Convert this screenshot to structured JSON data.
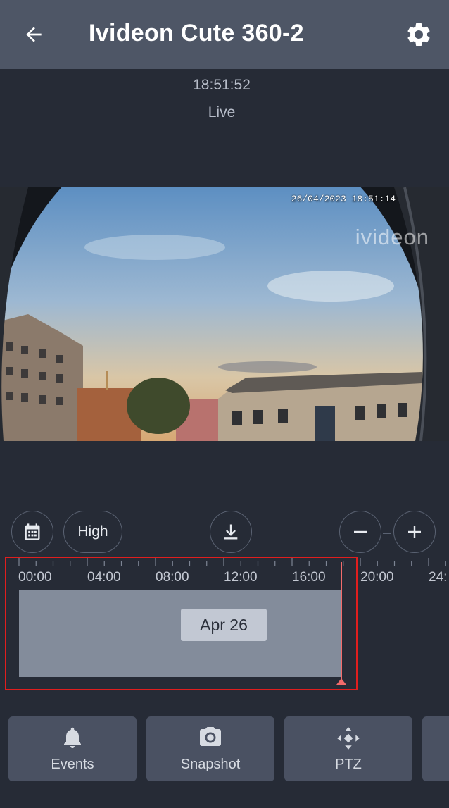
{
  "header": {
    "title": "Ivideon Cute 360-2",
    "back_icon": "arrow-left-icon",
    "settings_icon": "gear-icon"
  },
  "status": {
    "time": "18:51:52",
    "mode": "Live"
  },
  "video": {
    "overlay_timestamp": "26/04/2023 18:51:14",
    "watermark": "ivideon"
  },
  "controls": {
    "calendar_icon": "calendar-icon",
    "quality": "High",
    "download_icon": "download-icon",
    "zoom_out_icon": "minus-icon",
    "zoom_in_icon": "plus-icon"
  },
  "timeline": {
    "hour_labels": [
      "00:00",
      "04:00",
      "08:00",
      "12:00",
      "16:00",
      "20:00",
      "24:"
    ],
    "date_label": "Apr 26",
    "accent_color": "#f26b6b"
  },
  "actions": [
    {
      "label": "Events",
      "icon": "bell-icon"
    },
    {
      "label": "Snapshot",
      "icon": "camera-icon"
    },
    {
      "label": "PTZ",
      "icon": "ptz-arrows-icon"
    }
  ]
}
